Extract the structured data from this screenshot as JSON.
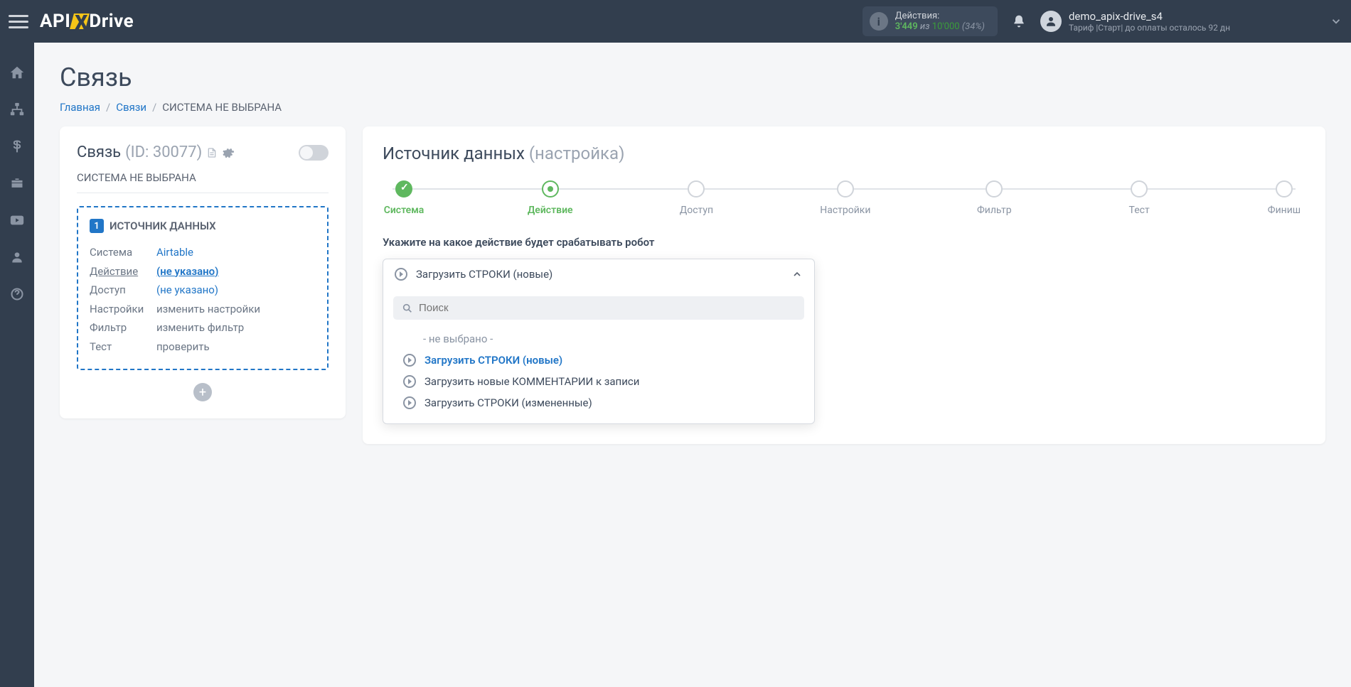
{
  "header": {
    "logo_api": "API",
    "logo_drive": "Drive",
    "actions_label": "Действия:",
    "actions_used": "3'449",
    "actions_of": "из",
    "actions_total": "10'000",
    "actions_pct": "(34%)",
    "user_name": "demo_apix-drive_s4",
    "user_plan": "Тариф |Старт| до оплаты осталось 92 дн"
  },
  "page": {
    "title": "Связь",
    "breadcrumb": {
      "home": "Главная",
      "links": "Связи",
      "current": "СИСТЕМА НЕ ВЫБРАНА"
    }
  },
  "left_panel": {
    "title": "Связь",
    "id": "(ID: 30077)",
    "subtitle": "СИСТЕМА НЕ ВЫБРАНА",
    "source_badge": "1",
    "source_title": "ИСТОЧНИК ДАННЫХ",
    "rows": {
      "system_lbl": "Система",
      "system_val": "Airtable",
      "action_lbl": "Действие",
      "action_val": "(не указано)",
      "access_lbl": "Доступ",
      "access_val": "(не указано)",
      "settings_lbl": "Настройки",
      "settings_val": "изменить настройки",
      "filter_lbl": "Фильтр",
      "filter_val": "изменить фильтр",
      "test_lbl": "Тест",
      "test_val": "проверить"
    }
  },
  "right_panel": {
    "title": "Источник данных",
    "title_sub": "(настройка)",
    "steps": {
      "s1": "Система",
      "s2": "Действие",
      "s3": "Доступ",
      "s4": "Настройки",
      "s5": "Фильтр",
      "s6": "Тест",
      "s7": "Финиш"
    },
    "instruction": "Укажите на какое действие будет срабатывать робот",
    "dropdown": {
      "selected": "Загрузить СТРОКИ (новые)",
      "search_placeholder": "Поиск",
      "empty_option": "- не выбрано -",
      "opt1": "Загрузить СТРОКИ (новые)",
      "opt2": "Загрузить новые КОММЕНТАРИИ к записи",
      "opt3": "Загрузить СТРОКИ (измененные)"
    }
  }
}
